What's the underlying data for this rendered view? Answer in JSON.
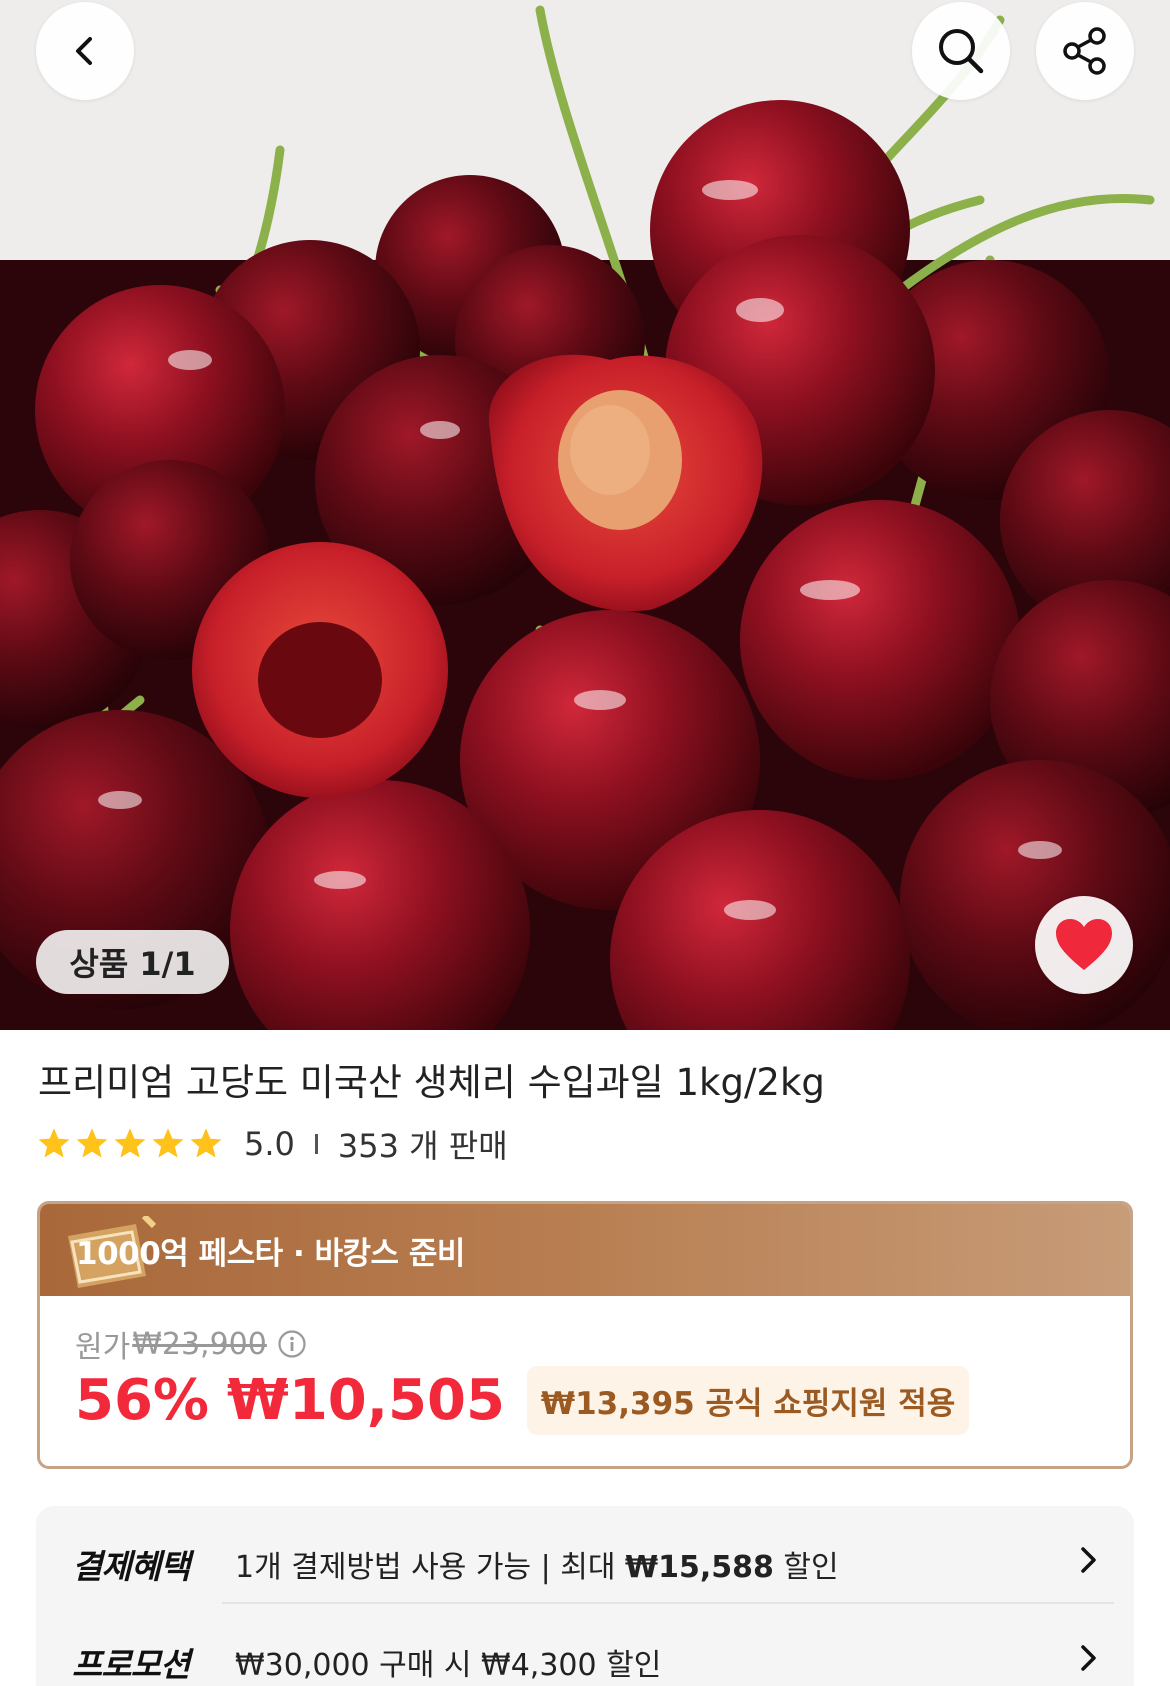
{
  "header": {
    "back_icon": "chevron-left-icon",
    "search_icon": "search-icon",
    "share_icon": "share-icon"
  },
  "gallery": {
    "counter_label": "상품 1/1",
    "wishlist_icon": "heart-icon",
    "wishlist_color": "#f0283c"
  },
  "product": {
    "title": "프리미엄 고당도 미국산 생체리  수입과일 1kg/2kg",
    "rating": "5.0",
    "stars": 5,
    "sold": "353 개 판매"
  },
  "promo": {
    "banner_title": "1000억 페스타 · 바캉스 준비",
    "original_label": "원가",
    "original_price": "₩23,900",
    "discount": "56%",
    "sale_price": "₩10,505",
    "support_text": "₩13,395 공식 쇼핑지원 적용",
    "accent_color": "#f2293a"
  },
  "benefits": [
    {
      "label": "결제혜택",
      "text_prefix": "1개 결제방법 사용 가능 | 최대 ",
      "text_bold": "₩15,588",
      "text_suffix": " 할인"
    },
    {
      "label": "프로모션",
      "text_prefix": "₩30,000 구매 시 ₩4,300 할인",
      "text_bold": "",
      "text_suffix": ""
    }
  ]
}
